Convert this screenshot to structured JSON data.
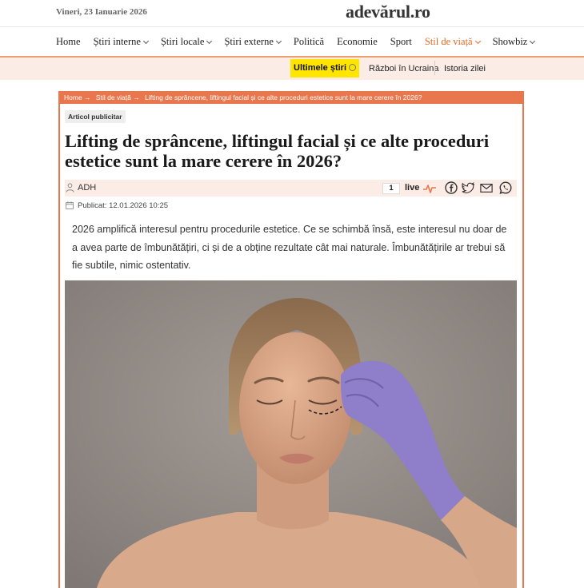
{
  "header": {
    "date": "Vineri, 23 Ianuarie 2026",
    "logo_text": "adevărul.ro"
  },
  "nav": {
    "items": [
      {
        "label": "Home",
        "has_dropdown": false
      },
      {
        "label": "Știri interne",
        "has_dropdown": true
      },
      {
        "label": "Știri locale",
        "has_dropdown": true
      },
      {
        "label": "Știri externe",
        "has_dropdown": true
      },
      {
        "label": "Politică",
        "has_dropdown": false
      },
      {
        "label": "Economie",
        "has_dropdown": false
      },
      {
        "label": "Sport",
        "has_dropdown": false
      },
      {
        "label": "Stil de viață",
        "has_dropdown": true,
        "active": true
      },
      {
        "label": "Showbiz",
        "has_dropdown": true
      }
    ]
  },
  "subnav": {
    "latest": "Ultimele știri",
    "link1": "Război în Ucraina",
    "link2": "Istoria zilei"
  },
  "breadcrumb": {
    "home": "Home →",
    "section": "Stil de viață →",
    "current": "Lifting de sprâncene, liftingul facial și ce alte proceduri estetice sunt la mare cerere în 2026?"
  },
  "article": {
    "badge": "Articol publicitar",
    "title": "Lifting de sprâncene, liftingul facial și ce alte proceduri estetice sunt la mare cerere în 2026?",
    "author": "ADH",
    "comments_count": "1",
    "live_label": "live",
    "published": "Publicat: 12.01.2026 10:25",
    "lead": "2026 amplifică interesul pentru procedurile estetice. Ce se schimbă însă, este interesul nu doar de a avea parte de îmbunătățiri, ci și de a obține rezultate cât mai naturale. Îmbunătățirile ar trebui să fie subtile, nimic ostentativ."
  },
  "colors": {
    "accent": "#e8774d",
    "highlight": "#ffe500",
    "subbar_bg": "#fbece6"
  },
  "icons": [
    "user-icon",
    "pulse-icon",
    "facebook-icon",
    "twitter-icon",
    "email-icon",
    "whatsapp-icon",
    "calendar-icon",
    "clock-icon"
  ]
}
